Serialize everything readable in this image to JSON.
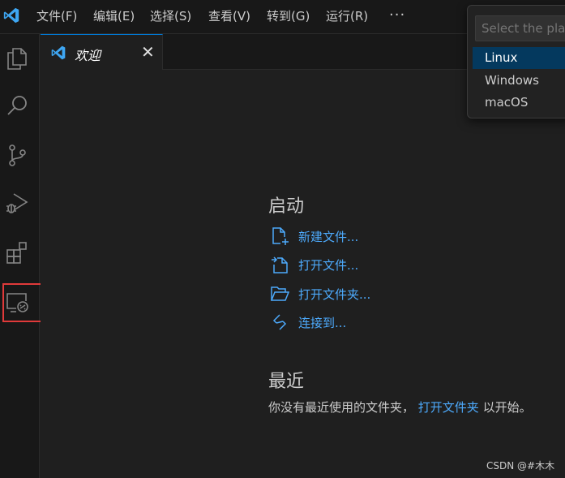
{
  "menu": {
    "items": [
      "文件(F)",
      "编辑(E)",
      "选择(S)",
      "查看(V)",
      "转到(G)",
      "运行(R)"
    ],
    "more": "···"
  },
  "tab": {
    "label": "欢迎",
    "close": "✕"
  },
  "welcome": {
    "start_title": "启动",
    "new_file": "新建文件...",
    "open_file": "打开文件...",
    "open_folder": "打开文件夹...",
    "connect": "连接到...",
    "recent_title": "最近",
    "recent_prefix": "你没有最近使用的文件夹，",
    "recent_link": "打开文件夹",
    "recent_suffix": "以开始。"
  },
  "quickpick": {
    "placeholder": "Select the platform",
    "options": [
      "Linux",
      "Windows",
      "macOS"
    ],
    "selected": "Linux"
  },
  "watermark": "CSDN @#木木",
  "colors": {
    "accent": "#0078d4",
    "link": "#4daafc",
    "highlight_box": "#e03a3a",
    "selected_option": "#04395e"
  },
  "icons": {
    "activity": [
      "explorer-icon",
      "search-icon",
      "source-control-icon",
      "run-debug-icon",
      "extensions-icon",
      "remote-explorer-icon"
    ]
  }
}
